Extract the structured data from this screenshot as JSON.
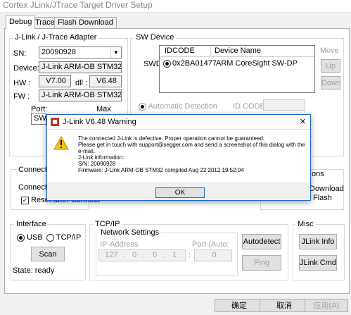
{
  "window": {
    "title": "Cortex JLink/JTrace Target Driver Setup"
  },
  "tabs": [
    {
      "label": "Debug"
    },
    {
      "label": "Trace"
    },
    {
      "label": "Flash Download"
    }
  ],
  "jlink": {
    "group_label": "J-Link / J-Trace Adapter",
    "sn_label": "SN:",
    "sn_value": "20090928",
    "device_label": "Device:",
    "device_value": "J-Link ARM-OB STM32",
    "hw_label": "HW :",
    "hw_value": "V7.00",
    "dll_label": "dll :",
    "dll_value": "V6.48",
    "fw_label": "FW :",
    "fw_value": "J-Link ARM-OB STM32 comp",
    "port_label": "Port:",
    "port_value": "SW",
    "max_label": "Max"
  },
  "swdevice": {
    "group_label": "SW Device",
    "swdi_label": "SWDI",
    "col_idcode": "IDCODE",
    "col_device": "Device Name",
    "rows": [
      {
        "idcode": "0x2BA01477",
        "device": "ARM CoreSight SW-DP"
      }
    ],
    "move_label": "Move",
    "up_label": "Up",
    "down_label": "Down",
    "auto_detect_label": "Automatic Detection",
    "idcode_label": "ID CODE:"
  },
  "connect": {
    "group_label": "Connect &",
    "connect_label": "Connect:",
    "reset_after_connect": "Reset after Connect",
    "right_group_tail": "ons",
    "download_label": "Download",
    "flash_label": "Flash"
  },
  "interface": {
    "group_label": "Interface",
    "usb_label": "USB",
    "tcpip_label": "TCP/IP",
    "scan_label": "Scan",
    "state_label": "State: ready"
  },
  "tcpip": {
    "group_label": "TCP/IP",
    "network_label": "Network Settings",
    "ip_label": "IP-Address",
    "port_label": "Port (Auto:",
    "ip_parts": [
      "127",
      "0",
      "0",
      "1"
    ],
    "port_value": "0",
    "autodetect_label": "Autodetect",
    "ping_label": "Ping"
  },
  "misc": {
    "group_label": "Misc",
    "jlink_info_label": "JLink Info",
    "jlink_cmd_label": "JLink Cmd"
  },
  "footer": {
    "ok_label": "确定",
    "cancel_label": "取消",
    "apply_label": "应用(A)"
  },
  "dialog": {
    "title": "J-Link V6.48 Warning",
    "line1": "The connected J-Link is defective. Proper operation cannot be guaranteed.",
    "line2": "Please get in touch with support@segger.com and send a screenshot of this dialog with the e-mail.",
    "info_header": "J-Link information:",
    "info_sn": "S/N: 20090928",
    "info_fw": "Firmware: J-Link ARM-OB STM32 compiled Aug 22 2012 19:52:04",
    "ok_label": "OK",
    "close_glyph": "✕"
  },
  "colors": {
    "dialog_border": "#1b6ac9",
    "warning": "#f5c211"
  }
}
